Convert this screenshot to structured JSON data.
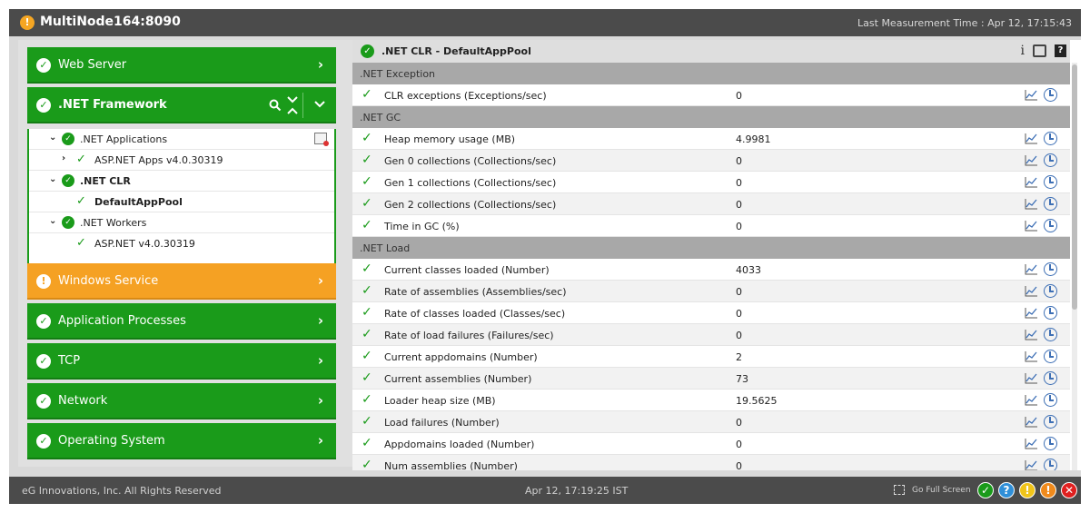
{
  "window": {
    "title": "MultiNode164:8090",
    "last_measurement": "Last Measurement Time : Apr 12, 17:15:43"
  },
  "sidebar": {
    "items": [
      {
        "label": "Web Server",
        "status": "ok"
      },
      {
        "label": ".NET Framework",
        "status": "ok"
      },
      {
        "label": "Windows Service",
        "status": "warning"
      },
      {
        "label": "Application Processes",
        "status": "ok"
      },
      {
        "label": "TCP",
        "status": "ok"
      },
      {
        "label": "Network",
        "status": "ok"
      },
      {
        "label": "Operating System",
        "status": "ok"
      }
    ],
    "tree": [
      {
        "label": ".NET Applications"
      },
      {
        "label": "ASP.NET Apps v4.0.30319"
      },
      {
        "label": ".NET CLR"
      },
      {
        "label": "DefaultAppPool"
      },
      {
        "label": ".NET Workers"
      },
      {
        "label": "ASP.NET v4.0.30319"
      }
    ]
  },
  "main": {
    "title": ".NET CLR - DefaultAppPool",
    "sections": [
      {
        "label": ".NET Exception"
      },
      {
        "label": ".NET GC"
      },
      {
        "label": ".NET Load"
      }
    ],
    "rows": [
      {
        "name": "CLR exceptions (Exceptions/sec)",
        "value": "0"
      },
      {
        "name": "Heap memory usage (MB)",
        "value": "4.9981"
      },
      {
        "name": "Gen 0 collections (Collections/sec)",
        "value": "0"
      },
      {
        "name": "Gen 1 collections (Collections/sec)",
        "value": "0"
      },
      {
        "name": "Gen 2 collections (Collections/sec)",
        "value": "0"
      },
      {
        "name": "Time in GC (%)",
        "value": "0"
      },
      {
        "name": "Current classes loaded (Number)",
        "value": "4033"
      },
      {
        "name": "Rate of assemblies (Assemblies/sec)",
        "value": "0"
      },
      {
        "name": "Rate of classes loaded (Classes/sec)",
        "value": "0"
      },
      {
        "name": "Rate of load failures (Failures/sec)",
        "value": "0"
      },
      {
        "name": "Current appdomains (Number)",
        "value": "2"
      },
      {
        "name": "Current assemblies (Number)",
        "value": "73"
      },
      {
        "name": "Loader heap size (MB)",
        "value": "19.5625"
      },
      {
        "name": "Load failures (Number)",
        "value": "0"
      },
      {
        "name": "Appdomains loaded (Number)",
        "value": "0"
      },
      {
        "name": "Num assemblies (Number)",
        "value": "0"
      }
    ]
  },
  "footer": {
    "copyright": "eG Innovations, Inc. All Rights Reserved",
    "time": "Apr 12, 17:19:25 IST",
    "full_screen": "Go Full Screen"
  },
  "colors": {
    "ok": "#1a9b1a",
    "warning": "#f5a123",
    "info": "#2f8fd8",
    "minor": "#f0c419",
    "major": "#f08a1c",
    "critical": "#e02020"
  },
  "icons": [
    "warning-icon",
    "check-icon",
    "chevron-right-icon",
    "search-icon",
    "collapse-icon",
    "chevron-down-icon",
    "edit-icon",
    "info-icon",
    "detach-icon",
    "help-icon",
    "graph-icon",
    "history-icon",
    "full-screen-icon"
  ]
}
